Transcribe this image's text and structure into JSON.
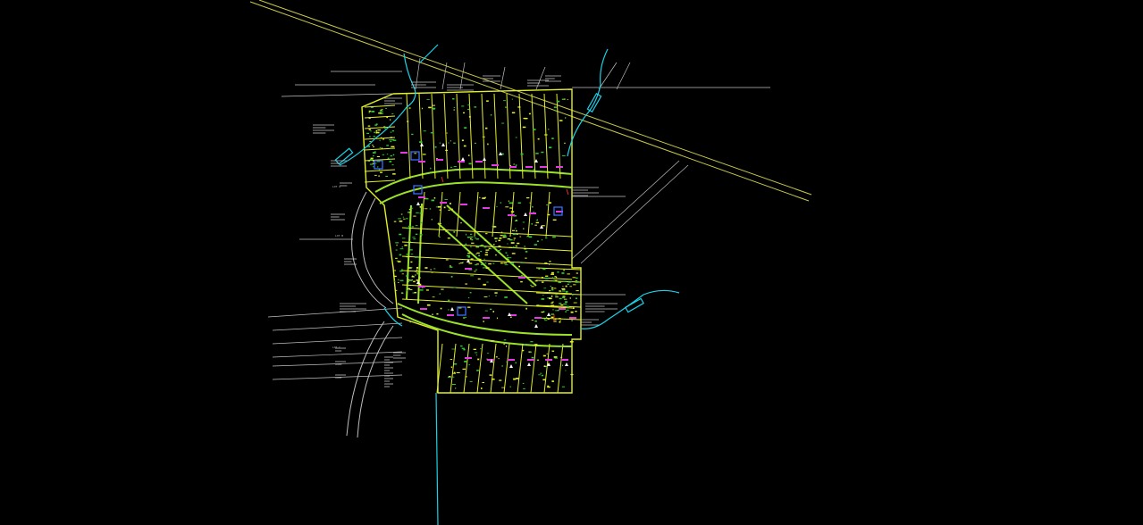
{
  "canvas": {
    "background": "#000000"
  },
  "colors": {
    "railroad": "#c8c84a",
    "lot_lines": "#e2ef2a",
    "road_edge": "#9be22a",
    "green": "#35c935",
    "water": "#1bd1e8",
    "labels_magenta": "#e23be2",
    "adjacent": "#bfbfbf",
    "blue_box": "#3a6cff",
    "white": "#ffffff",
    "red": "#e8302b"
  },
  "labels": {
    "lot_a": "LOT A",
    "lot_b": "LOT B",
    "lot_c": "LOT C"
  }
}
